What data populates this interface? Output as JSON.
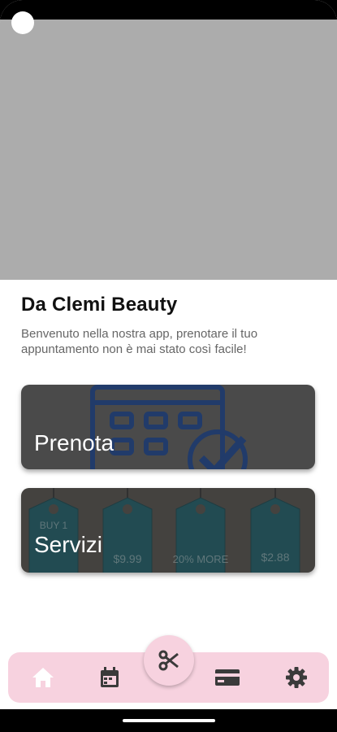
{
  "header": {
    "title": "Da Clemi Beauty",
    "subtitle": "Benvenuto nella nostra app, prenotare il tuo appuntamento non è mai stato così facile!"
  },
  "cards": [
    {
      "label": "Prenota",
      "icon": "calendar-check-icon"
    },
    {
      "label": "Servizi",
      "tags": [
        "BUY 1",
        "$9.99",
        "20% MORE",
        "$2.88"
      ]
    }
  ],
  "bottom_nav": {
    "items": [
      {
        "icon": "home-icon",
        "color": "#ffffff"
      },
      {
        "icon": "calendar-icon",
        "color": "#3a3a3a"
      },
      {
        "icon": "scissors-icon",
        "color": "#3a3a3a"
      },
      {
        "icon": "credit-card-icon",
        "color": "#3a3a3a"
      },
      {
        "icon": "gear-icon",
        "color": "#3a3a3a"
      }
    ],
    "background": "#f7d2df"
  },
  "colors": {
    "hero_placeholder": "#acacac",
    "card_overlay": "#4a4a4a",
    "tag_teal": "#0f5a66"
  }
}
